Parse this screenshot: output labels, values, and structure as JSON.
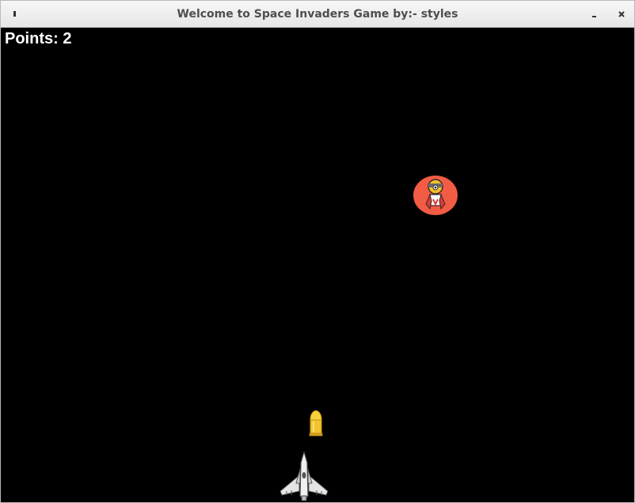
{
  "window": {
    "title": "Welcome to Space Invaders Game by:- styles"
  },
  "game": {
    "score_text": "Points: 2",
    "score": 2,
    "background": "#000000",
    "enemy_color": "#f25c45",
    "bullet_color": "#f2c230",
    "player_color": "#e4e4e4"
  }
}
